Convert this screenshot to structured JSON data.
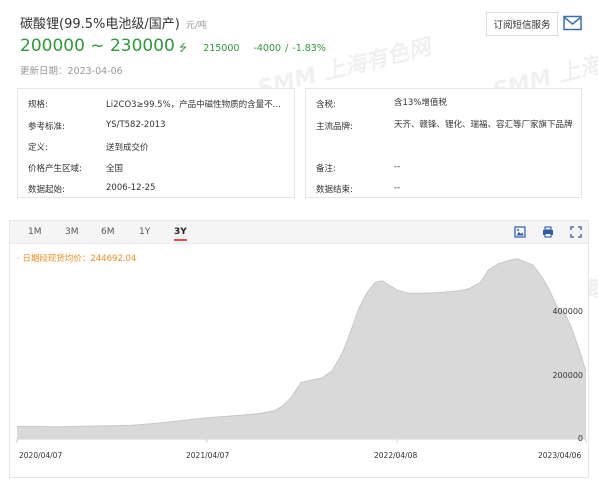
{
  "header": {
    "title": "碳酸锂(99.5%电池级/国产)",
    "unit": "元/吨",
    "price_range": "200000 ~ 230000",
    "trend_icon": "down-arrow",
    "avg_price": "215000",
    "change": "-4000",
    "separator": "/",
    "change_pct": "-1.83%",
    "update_date": "更新日期：2023-04-06",
    "subscribe_label": "订阅短信服务",
    "price_color": "#2f9a3a"
  },
  "info_left": [
    {
      "key": "规格:",
      "value": "Li2CO3≥99.5%，产品中磁性物质的含量不..."
    },
    {
      "key": "参考标准:",
      "value": "YS/T582-2013"
    },
    {
      "key": "定义:",
      "value": "送到成交价"
    },
    {
      "key": "价格产生区域:",
      "value": "全国"
    },
    {
      "key": "数据起始:",
      "value": "2006-12-25"
    }
  ],
  "info_right": [
    {
      "key": "含税:",
      "value": "含13%增值税"
    },
    {
      "key": "主流品牌:",
      "value": "天齐、赣锋、锂化、瑞福、容汇等厂家旗下品牌"
    },
    {
      "key": "备注:",
      "value": "--"
    },
    {
      "key": "数据结束:",
      "value": "--"
    }
  ],
  "chart_tabs": [
    "1M",
    "3M",
    "6M",
    "1Y",
    "3Y"
  ],
  "active_tab": "3Y",
  "watermark": "SMM 上海有色网",
  "chart_data": {
    "type": "area",
    "legend": "日期段现货均价：244692.04",
    "x_tick_labels": [
      "2020/04/07",
      "2021/04/07",
      "2022/04/08",
      "2023/04/06"
    ],
    "y_tick_labels": [
      "0",
      "200000",
      "400000"
    ],
    "ylim": [
      0,
      600000
    ],
    "x": [
      "2020-04-07",
      "2020-05-15",
      "2020-07-01",
      "2020-08-15",
      "2020-10-01",
      "2020-11-15",
      "2021-01-01",
      "2021-02-15",
      "2021-04-07",
      "2021-05-15",
      "2021-06-20",
      "2021-07-20",
      "2021-08-15",
      "2021-08-30",
      "2021-09-15",
      "2021-10-05",
      "2021-10-25",
      "2021-11-15",
      "2021-12-05",
      "2021-12-25",
      "2022-01-10",
      "2022-01-25",
      "2022-02-10",
      "2022-02-25",
      "2022-03-10",
      "2022-04-08",
      "2022-05-01",
      "2022-06-01",
      "2022-07-01",
      "2022-08-01",
      "2022-08-25",
      "2022-09-15",
      "2022-10-01",
      "2022-10-20",
      "2022-11-10",
      "2022-11-25",
      "2022-12-10",
      "2022-12-25",
      "2023-01-10",
      "2023-01-25",
      "2023-02-10",
      "2023-02-25",
      "2023-03-10",
      "2023-03-25",
      "2023-04-06"
    ],
    "y": [
      40000,
      40000,
      39000,
      41000,
      42000,
      44000,
      50000,
      58000,
      68000,
      72000,
      77000,
      82000,
      90000,
      105000,
      130000,
      180000,
      188000,
      195000,
      220000,
      280000,
      350000,
      420000,
      470000,
      500000,
      505000,
      475000,
      465000,
      465000,
      468000,
      472000,
      480000,
      500000,
      540000,
      560000,
      570000,
      575000,
      565000,
      555000,
      520000,
      478000,
      420000,
      400000,
      350000,
      280000,
      215000
    ],
    "area_color": "#d9d9d9",
    "line_color": "#c8c8c8"
  }
}
